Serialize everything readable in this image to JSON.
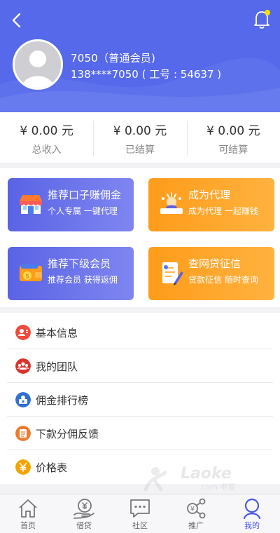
{
  "header": {
    "user_name": "7050（普通会员)",
    "user_phone": "138****7050 ( 工号 : 54637 )",
    "notification_dot_color": "#f8e000"
  },
  "stats": [
    {
      "amount": "¥ 0.00 元",
      "label": "总收入"
    },
    {
      "amount": "¥ 0.00 元",
      "label": "已结算"
    },
    {
      "amount": "¥ 0.00 元",
      "label": "可结算"
    }
  ],
  "cards": [
    {
      "title": "推荐口子赚佣金",
      "subtitle": "个人专属 一键代理",
      "color": "blue",
      "icon": "shop-icon"
    },
    {
      "title": "成为代理",
      "subtitle": "成为代理 一起赚钱",
      "color": "orange",
      "icon": "agent-icon"
    },
    {
      "title": "推荐下级会员",
      "subtitle": "推荐会员 获得返佣",
      "color": "blue",
      "icon": "wallet-icon"
    },
    {
      "title": "查网贷征信",
      "subtitle": "贷款征信 随时查询",
      "color": "orange",
      "icon": "credit-report-icon"
    }
  ],
  "menu": [
    {
      "label": "基本信息",
      "icon": "user-info-icon",
      "color": "#f04a3c"
    },
    {
      "label": "我的团队",
      "icon": "team-icon",
      "color": "#d9342b"
    },
    {
      "label": "佣金排行榜",
      "icon": "ranking-icon",
      "color": "#2f6fd6"
    },
    {
      "label": "下款分佣反馈",
      "icon": "feedback-icon",
      "color": "#f07a2c"
    },
    {
      "label": "价格表",
      "icon": "price-icon",
      "color": "#f5a300"
    }
  ],
  "watermark": {
    "brand": "Laoke",
    "domain": ".com 老客"
  },
  "tabs": [
    {
      "label": "首页",
      "icon": "home-icon",
      "active": false
    },
    {
      "label": "借贷",
      "icon": "loan-icon",
      "active": false
    },
    {
      "label": "社区",
      "icon": "community-icon",
      "active": false
    },
    {
      "label": "推广",
      "icon": "share-icon",
      "active": false
    },
    {
      "label": "我的",
      "icon": "profile-icon",
      "active": true
    }
  ],
  "colors": {
    "primary": "#5569ea",
    "orange": "#ff9c1a",
    "tab_active": "#4b57e6"
  }
}
